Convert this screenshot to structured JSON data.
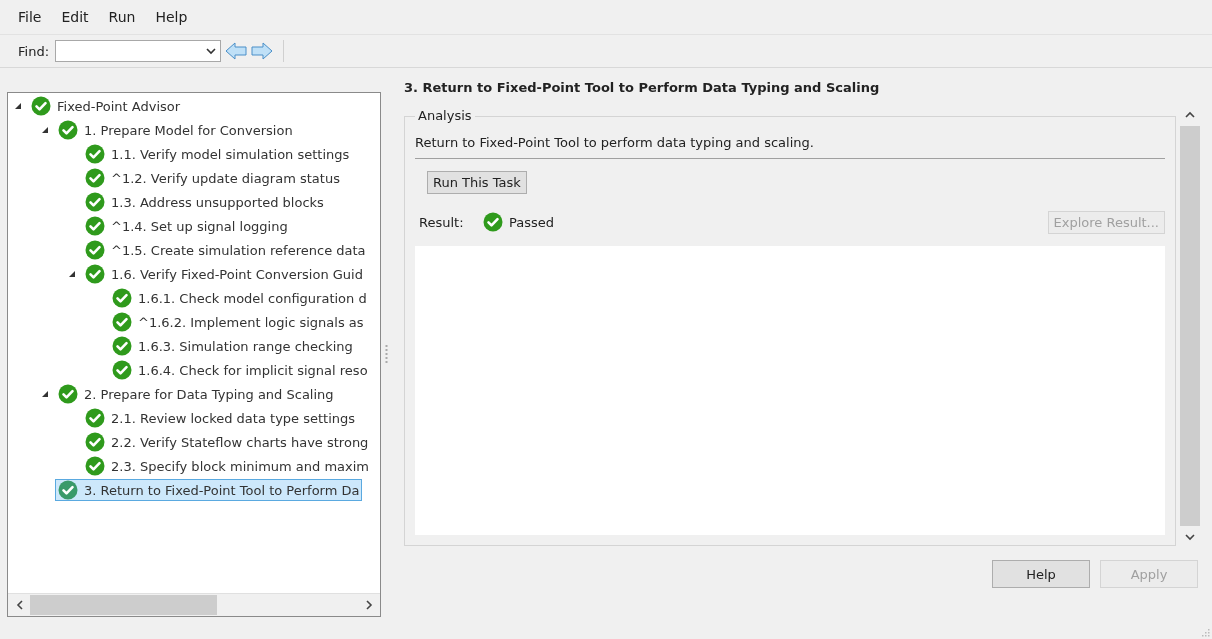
{
  "menu": [
    "File",
    "Edit",
    "Run",
    "Help"
  ],
  "toolbar": {
    "find_label": "Find:"
  },
  "tree": [
    {
      "label": "Fixed-Point Advisor",
      "kind": "passed",
      "expanded": true,
      "selected": false,
      "children": [
        {
          "label": "1. Prepare Model for Conversion",
          "kind": "passed",
          "expanded": true,
          "selected": false,
          "children": [
            {
              "label": "1.1. Verify model simulation settings",
              "kind": "passed",
              "selected": false
            },
            {
              "label": "^1.2. Verify update diagram status",
              "kind": "passed",
              "selected": false
            },
            {
              "label": "1.3. Address unsupported blocks",
              "kind": "passed",
              "selected": false
            },
            {
              "label": "^1.4. Set up signal logging",
              "kind": "passed",
              "selected": false
            },
            {
              "label": "^1.5. Create simulation reference data",
              "kind": "passed",
              "selected": false
            },
            {
              "label": "1.6. Verify Fixed-Point Conversion Guid",
              "kind": "passed",
              "expanded": true,
              "selected": false,
              "children": [
                {
                  "label": "1.6.1. Check model configuration d",
                  "kind": "passed",
                  "selected": false
                },
                {
                  "label": "^1.6.2. Implement logic signals as",
                  "kind": "passed",
                  "selected": false
                },
                {
                  "label": "1.6.3. Simulation range checking",
                  "kind": "passed",
                  "selected": false
                },
                {
                  "label": "1.6.4. Check for implicit signal reso",
                  "kind": "passed",
                  "selected": false
                }
              ]
            }
          ]
        },
        {
          "label": "2. Prepare for Data Typing and Scaling",
          "kind": "passed",
          "expanded": true,
          "selected": false,
          "children": [
            {
              "label": "2.1. Review locked data type settings",
              "kind": "passed",
              "selected": false
            },
            {
              "label": "2.2. Verify Stateflow charts have strong",
              "kind": "passed",
              "selected": false
            },
            {
              "label": "2.3. Specify block minimum and maxim",
              "kind": "passed",
              "selected": false
            }
          ]
        },
        {
          "label": "3. Return to Fixed-Point Tool to Perform Da",
          "kind": "passed",
          "selected": true
        }
      ]
    }
  ],
  "detail": {
    "title": "3. Return to Fixed-Point Tool to Perform Data Typing and Scaling",
    "group_label": "Analysis",
    "description": "Return to Fixed-Point Tool to perform data typing and scaling.",
    "run_button": "Run This Task",
    "result_label": "Result:",
    "result": {
      "kind": "passed",
      "text": "Passed"
    },
    "explore_button": {
      "label": "Explore Result...",
      "disabled": true
    }
  },
  "buttons": [
    {
      "label": "Help",
      "disabled": false
    },
    {
      "label": "Apply",
      "disabled": true
    }
  ]
}
